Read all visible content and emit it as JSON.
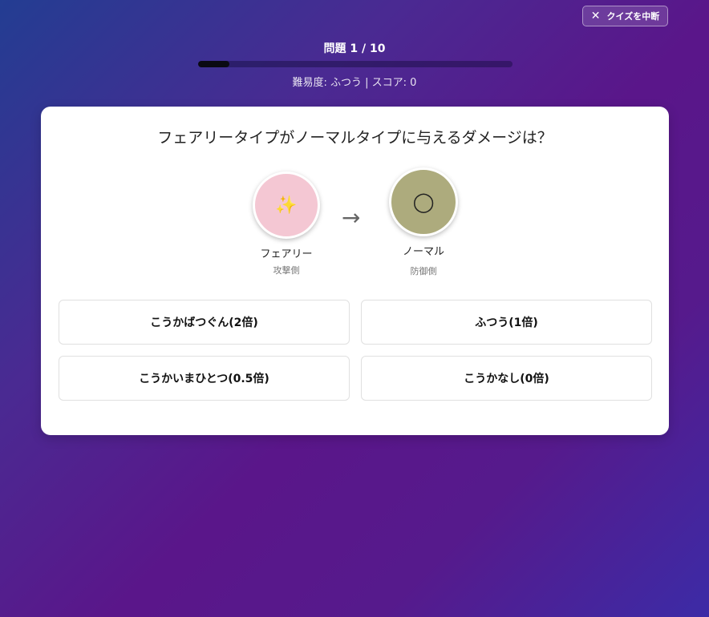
{
  "header": {
    "quit_icon": "close-icon",
    "quit_label": "クイズを中断",
    "progress_label": "問題 1 / 10",
    "progress_fraction": 0.1,
    "difficulty_text": "難易度: ふつう | スコア: 0"
  },
  "question": {
    "text": "フェアリータイプがノーマルタイプに与えるダメージは？",
    "attacker": {
      "name": "フェアリー",
      "role": "攻撃側",
      "icon": "sparkles-icon",
      "glyph": "✨",
      "color": "#f4c7d3"
    },
    "arrow": "→",
    "defender": {
      "name": "ノーマル",
      "role": "防御側",
      "icon": "circle-icon",
      "glyph": "◯",
      "color": "#adab7d"
    }
  },
  "answers": [
    {
      "label": "こうかばつぐん(2倍)"
    },
    {
      "label": "ふつう(1倍)"
    },
    {
      "label": "こうかいまひとつ(0.5倍)"
    },
    {
      "label": "こうかなし(0倍)"
    }
  ]
}
